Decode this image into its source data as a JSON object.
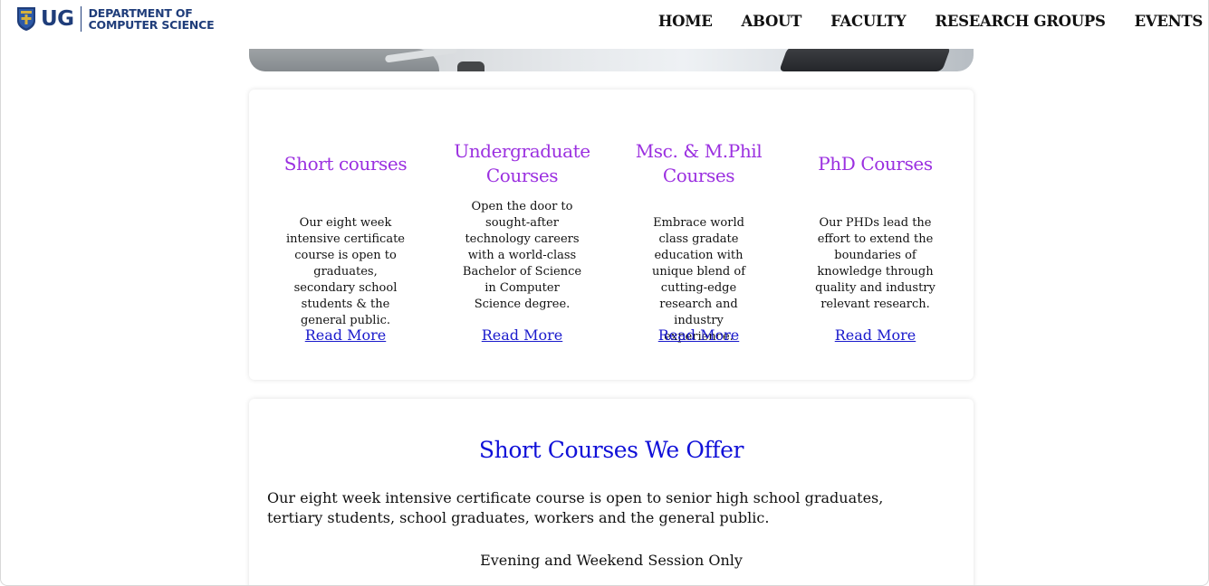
{
  "header": {
    "logo_text": "UG",
    "dept_line1": "DEPARTMENT OF",
    "dept_line2": "COMPUTER SCIENCE",
    "nav": [
      "HOME",
      "ABOUT",
      "FACULTY",
      "RESEARCH GROUPS",
      "EVENTS"
    ]
  },
  "courses": [
    {
      "title": "Short courses",
      "description": "Our eight week intensive certificate course is open to graduates, secondary school students & the general public.",
      "link": "Read More"
    },
    {
      "title": "Undergraduate Courses",
      "description": "Open the door to sought-after technology careers with a world-class Bachelor of Science in Computer Science degree.",
      "link": "Read More"
    },
    {
      "title": "Msc. & M.Phil Courses",
      "description": "Embrace world class gradate education with unique blend of cutting-edge research and industry experience.",
      "link": "Read More"
    },
    {
      "title": "PhD Courses",
      "description": "Our PHDs lead the effort to extend the boundaries of knowledge through quality and industry relevant research.",
      "link": "Read More"
    }
  ],
  "short_courses": {
    "heading": "Short Courses We Offer",
    "description": "Our eight week intensive certificate course is open to senior high school graduates, tertiary students, school graduates, workers and the general public.",
    "session": "Evening and Weekend Session Only"
  },
  "colors": {
    "course_title": "#9b30e0",
    "heading": "#1010d8",
    "link": "#1a1acc",
    "brand": "#1f3d7a"
  }
}
